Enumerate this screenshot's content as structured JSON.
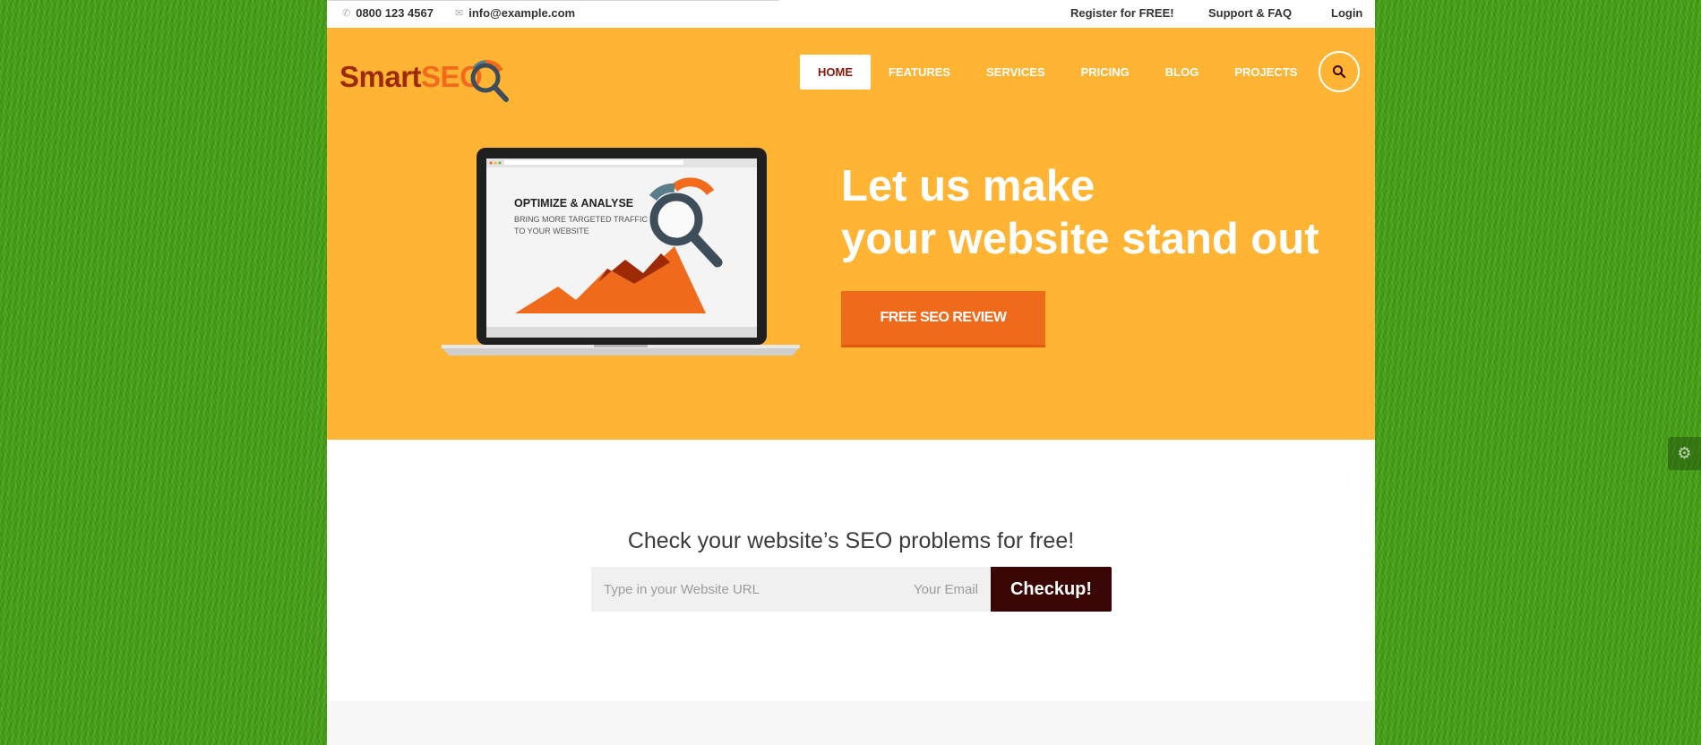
{
  "topbar": {
    "phone": "0800 123 4567",
    "email": "info@example.com",
    "links": [
      "Register for FREE!",
      "Support & FAQ",
      "Login"
    ]
  },
  "logo": {
    "part1": "Smart",
    "part2": "SEO"
  },
  "nav": {
    "items": [
      "HOME",
      "FEATURES",
      "SERVICES",
      "PRICING",
      "BLOG",
      "PROJECTS"
    ],
    "active": "HOME",
    "search_icon": "search-icon"
  },
  "hero": {
    "title_line1": "Let us make",
    "title_line2": "your website stand out",
    "cta_label": "FREE SEO REVIEW",
    "laptop_screen": {
      "heading": "OPTIMIZE & ANALYSE",
      "sub_line1": "BRING MORE TARGETED TRAFFIC",
      "sub_line2": "TO YOUR WEBSITE"
    }
  },
  "checkup": {
    "title": "Check your website’s SEO problems for free!",
    "url_placeholder": "Type in your Website URL",
    "email_placeholder": "Your Email",
    "button_label": "Checkup!"
  },
  "settings_icon": "gear-icon",
  "colors": {
    "hero_bg": "#ffb533",
    "cta_bg": "#f06a1c",
    "checkup_button": "#3a0505",
    "nav_active_text": "#8a1b0a",
    "logo_dark": "#9e2a05",
    "logo_light": "#f26b1d"
  }
}
